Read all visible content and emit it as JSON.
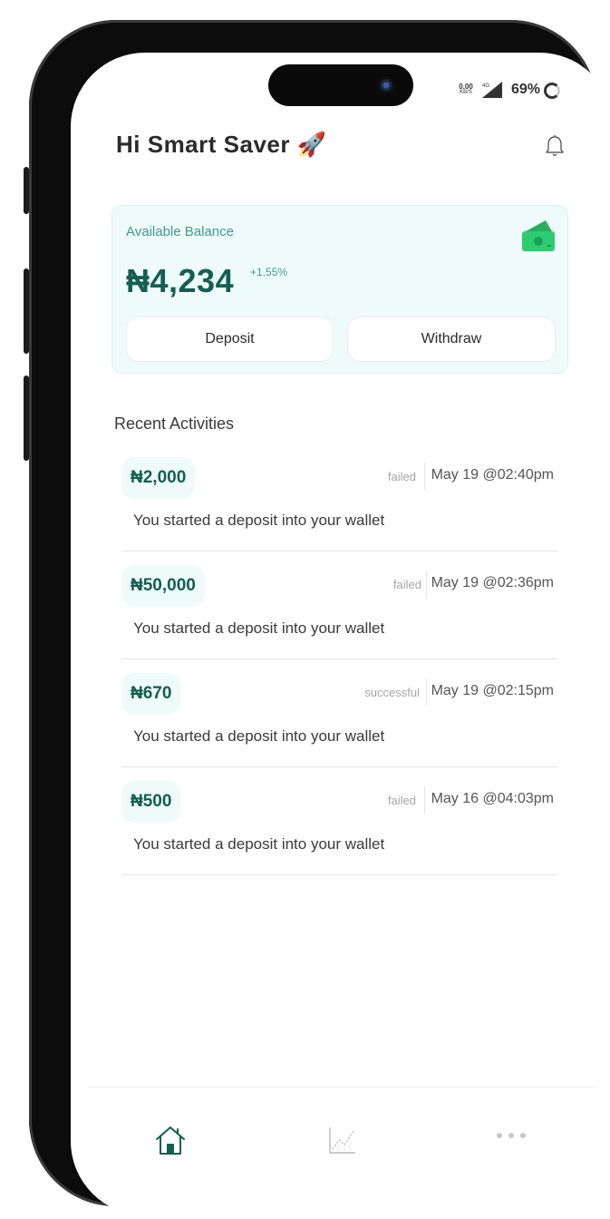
{
  "status_bar": {
    "net_speed": "0.00",
    "net_unit": "KB/S",
    "network_type": "4G",
    "battery": "69%"
  },
  "header": {
    "greeting": "Hi Smart Saver 🚀",
    "bell_icon": "bell-icon"
  },
  "balance_card": {
    "label": "Available Balance",
    "amount": "₦4,234",
    "change": "+1.55%",
    "icon": "money-icon",
    "deposit_label": "Deposit",
    "withdraw_label": "Withdraw"
  },
  "activities": {
    "title": "Recent Activities",
    "items": [
      {
        "amount": "₦2,000",
        "status": "failed",
        "timestamp": "May 19 @02:40pm",
        "description": "You started a deposit into your wallet"
      },
      {
        "amount": "₦50,000",
        "status": "failed",
        "timestamp": "May 19 @02:36pm",
        "description": "You started a deposit into your wallet"
      },
      {
        "amount": "₦670",
        "status": "successful",
        "timestamp": "May 19 @02:15pm",
        "description": "You started a deposit into your wallet"
      },
      {
        "amount": "₦500",
        "status": "failed",
        "timestamp": "May 16 @04:03pm",
        "description": "You started a deposit into your wallet"
      }
    ]
  },
  "nav": {
    "items": [
      "home-icon",
      "stats-icon",
      "more-icon"
    ],
    "active": "home-icon"
  },
  "colors": {
    "accent": "#145f52",
    "accent_light": "#3f9a8c",
    "card_bg": "#effbfb",
    "money_green": "#2ecc71"
  }
}
